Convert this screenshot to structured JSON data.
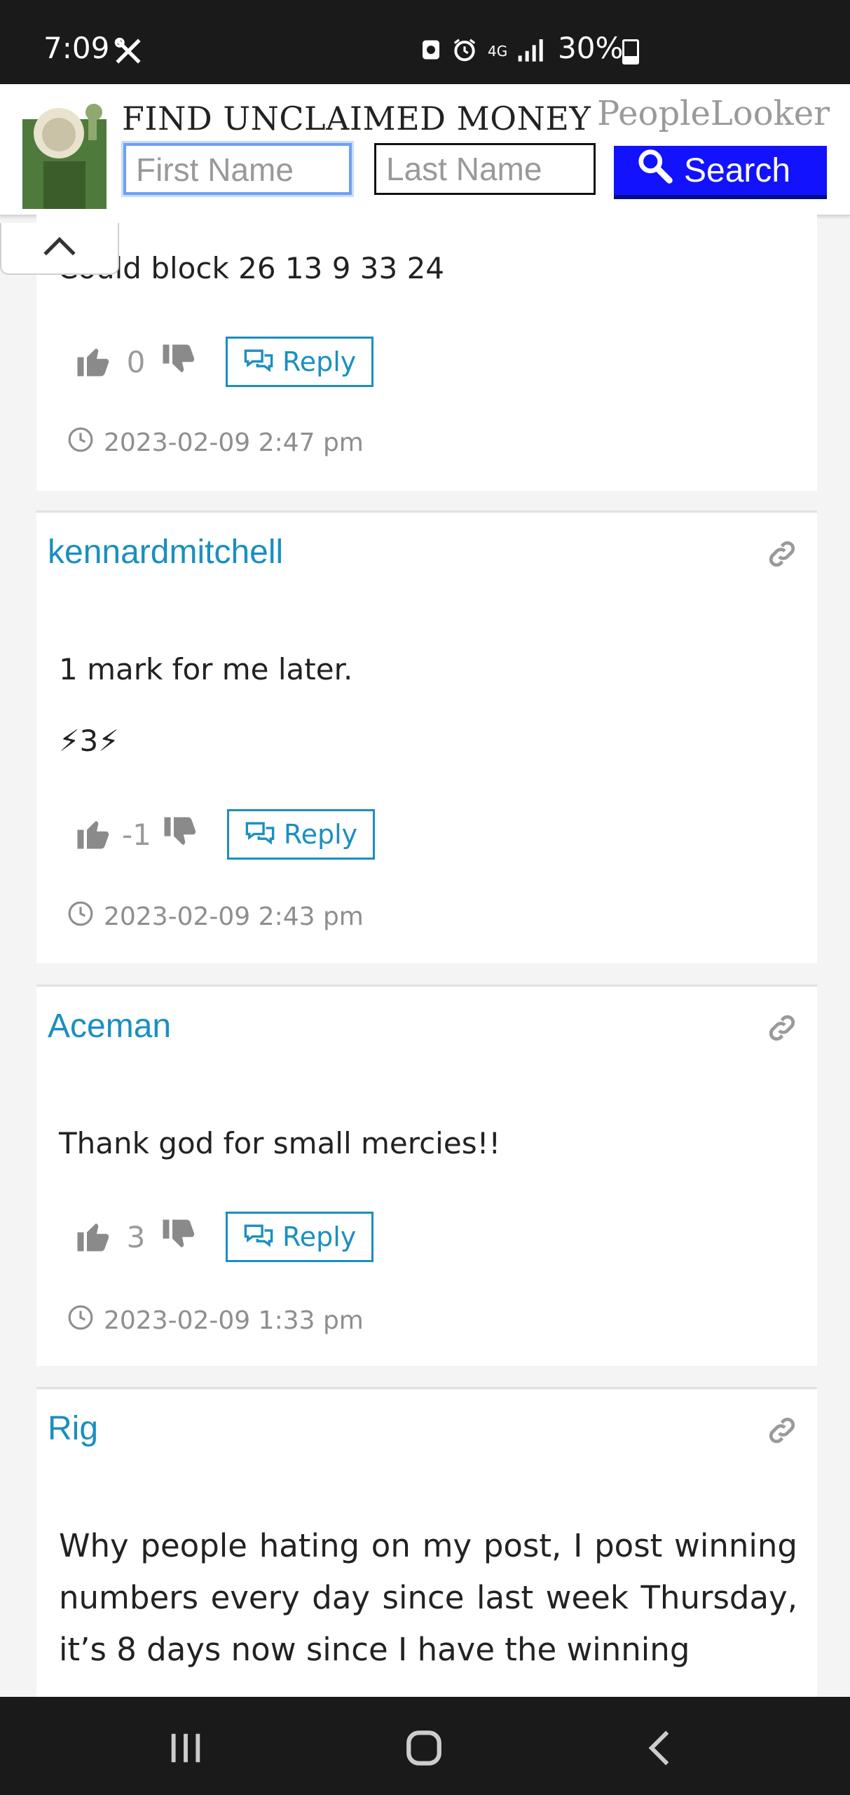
{
  "status_bar": {
    "time": "7:09",
    "network": "4G",
    "battery": "30%"
  },
  "ad": {
    "title": "FIND UNCLAIMED MONEY",
    "brand": "PeopleLooker",
    "first_name_placeholder": "First Name",
    "last_name_placeholder": "Last Name",
    "search_label": "Search"
  },
  "comments": [
    {
      "text": "Could block 26 13 9 33 24",
      "votes": "0",
      "reply_label": "Reply",
      "timestamp": "2023-02-09 2:47 pm"
    },
    {
      "author": "kennardmitchell",
      "text": "1 mark for me later.",
      "extra": "⚡3⚡",
      "votes": "-1",
      "reply_label": "Reply",
      "timestamp": "2023-02-09 2:43 pm"
    },
    {
      "author": "Aceman",
      "text": "Thank god for small mercies!!",
      "votes": "3",
      "reply_label": "Reply",
      "timestamp": "2023-02-09 1:33 pm"
    },
    {
      "author": "Rig",
      "text": "Why people hating on my post, I post winning numbers every day since last week Thursday, it’s 8 days now since I have the winning"
    }
  ],
  "colors": {
    "link": "#1a8fc0",
    "search_button": "#1212ff"
  }
}
